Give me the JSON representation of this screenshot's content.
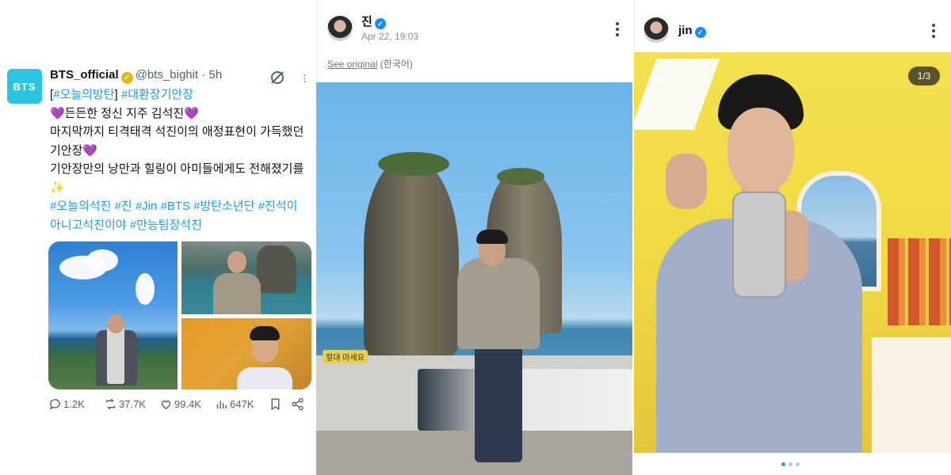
{
  "tweet": {
    "avatar_text": "BTS",
    "display_name": "BTS_official",
    "handle": "@bts_bighit",
    "separator": "·",
    "time": "5h",
    "lines": [
      {
        "type": "tags",
        "parts": [
          "[",
          "#오늘의방탄",
          "] ",
          "#대환장기안장"
        ]
      },
      {
        "type": "text",
        "text": "💜든든한 정신 지주 김석진💜"
      },
      {
        "type": "text",
        "text": "마지막까지 티격태격 석진이의 애정표현이 가득했던"
      },
      {
        "type": "text",
        "text": "기안장💜"
      },
      {
        "type": "text",
        "text": "기안장만의 낭만과 힐링이 아미들에게도 전해졌기를"
      },
      {
        "type": "text",
        "text": "✨"
      },
      {
        "type": "blank",
        "text": " "
      },
      {
        "type": "hashtags",
        "text": "#오늘의석진 #진 #Jin #BTS #방탄소년단 #진석이"
      },
      {
        "type": "hashtags",
        "text": "아니고석진이야 #만능팀장석진"
      }
    ],
    "stats": {
      "replies": "1.2K",
      "reposts": "37.7K",
      "likes": "99.4K",
      "views": "647K"
    }
  },
  "post_center": {
    "username": "진",
    "date": "Apr 22, 19:03",
    "see_original": "See original",
    "language": "(한국어)",
    "sign_text": "절대 마세요"
  },
  "post_right": {
    "username": "jin",
    "counter": "1/3",
    "carousel_total": 3,
    "carousel_active": 0
  },
  "colors": {
    "link": "#1d9bf0",
    "bts_avatar": "#2bc4e3",
    "gold_verified": "#e2b719",
    "blue_verified": "#1a8cff"
  }
}
